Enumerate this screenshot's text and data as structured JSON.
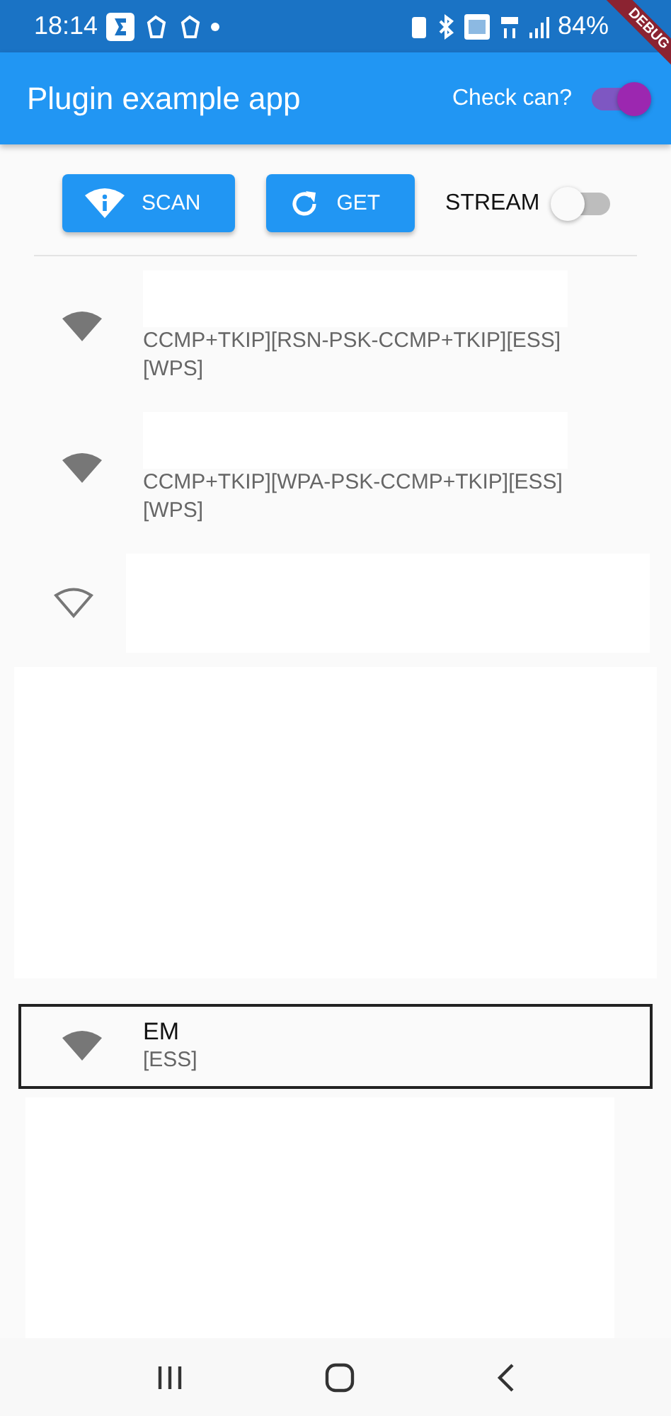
{
  "status_bar": {
    "time": "18:14",
    "battery": "84%"
  },
  "app_bar": {
    "title": "Plugin example app",
    "check_label": "Check can?",
    "check_on": true,
    "banner": "DEBUG"
  },
  "actions": {
    "buttons": [
      {
        "kind": "scan",
        "label": "SCAN"
      },
      {
        "kind": "get",
        "label": "GET"
      }
    ],
    "stream_label": "STREAM",
    "stream_on": false
  },
  "networks": [
    {
      "kind": "strong",
      "selected": false,
      "lines": [
        "CCMP+TKIP][RSN-PSK-CCMP+TKIP][ESS]",
        "[WPS]"
      ]
    },
    {
      "kind": "strong",
      "selected": false,
      "lines": [
        "CCMP+TKIP][WPA-PSK-CCMP+TKIP][ESS]",
        "[WPS]"
      ]
    },
    {
      "kind": "weak",
      "selected": false
    },
    {
      "kind": "strong",
      "selected": true,
      "title": "EM",
      "lines": [
        "[ESS]"
      ]
    }
  ]
}
